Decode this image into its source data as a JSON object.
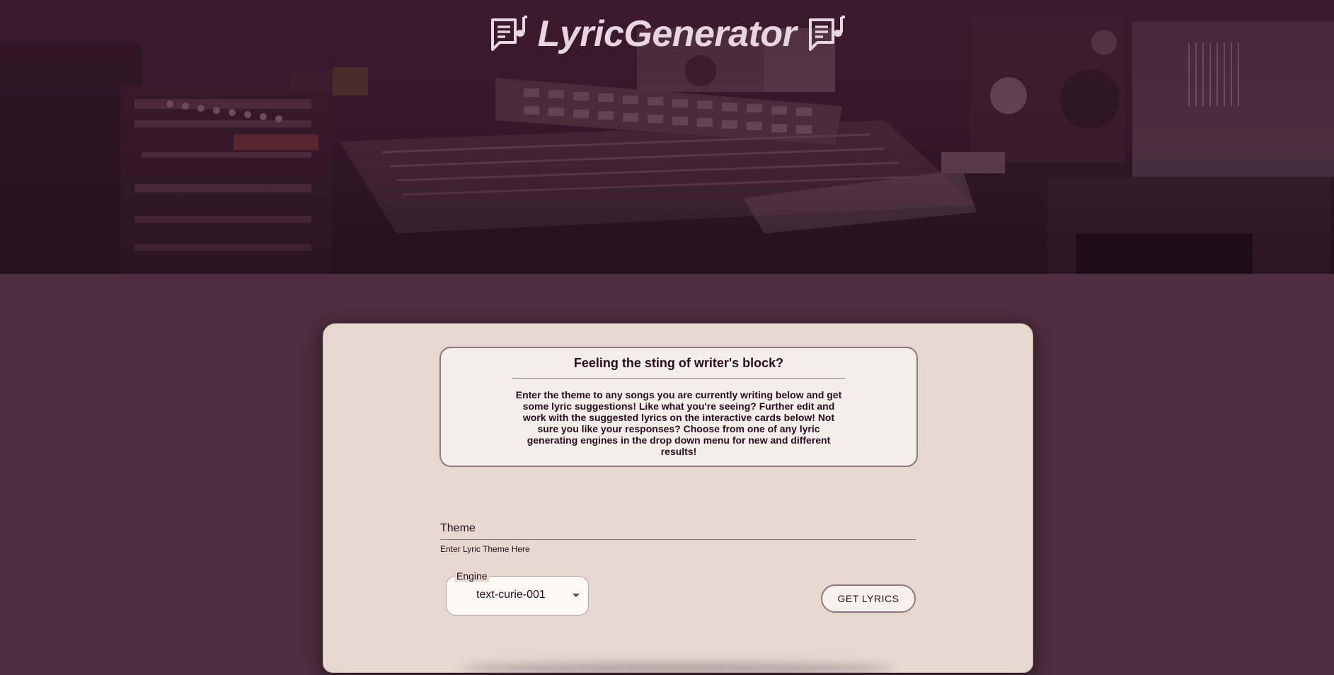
{
  "header": {
    "title": "LyricGenerator",
    "left_icon": "lyrics-note-icon",
    "right_icon": "lyrics-note-icon",
    "background": "recording-studio-photo"
  },
  "info": {
    "heading": "Feeling the sting of writer's block?",
    "body": "Enter the theme to any songs you are currently writing below and get some lyric suggestions! Like what you're seeing? Further edit and work with the suggested lyrics on the interactive cards below! Not sure you like your responses? Choose from one of any lyric generating engines in the drop down menu for new and different results!"
  },
  "form": {
    "theme_label": "Theme",
    "theme_value": "",
    "theme_helper": "Enter Lyric Theme Here",
    "engine_label": "Engine",
    "engine_value": "text-curie-001",
    "submit_label": "GET LYRICS"
  },
  "colors": {
    "page_bg": "#4e2e40",
    "card_bg": "#e5d8cf",
    "info_bg": "#f4eeeb",
    "accent_border": "#8e7683",
    "text_dark": "#2a0c1e",
    "title_text": "#e7d5df"
  }
}
